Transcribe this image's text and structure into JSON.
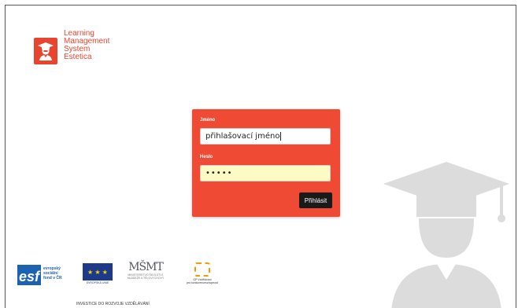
{
  "logo": {
    "lines": [
      "Learning",
      "Management",
      "System",
      "Estetica"
    ],
    "icon": "graduate-icon",
    "color": "#e8452f"
  },
  "login": {
    "username_label": "Jméno",
    "username_value": "přihlašovací jméno",
    "password_label": "Heslo",
    "password_value": "•••••",
    "submit_label": "Přihlásit",
    "panel_color": "#ee4a34"
  },
  "footer": {
    "esf": {
      "mark": "esf",
      "text": [
        "evropský",
        "sociální",
        "fond v ČR"
      ]
    },
    "eu": {
      "caption": "EVROPSKÁ UNIE"
    },
    "msmt": {
      "mark": "MŠMT",
      "caption": [
        "MINISTERSTVO ŠKOLSTVÍ,",
        "MLÁDEŽE A TĚLOVÝCHOVY"
      ]
    },
    "op": {
      "caption": [
        "OP Vzdělávání",
        "pro konkurenceschopnost"
      ]
    },
    "investice": "INVESTICE DO ROZVOJE VZDĚLÁVÁNÍ"
  }
}
